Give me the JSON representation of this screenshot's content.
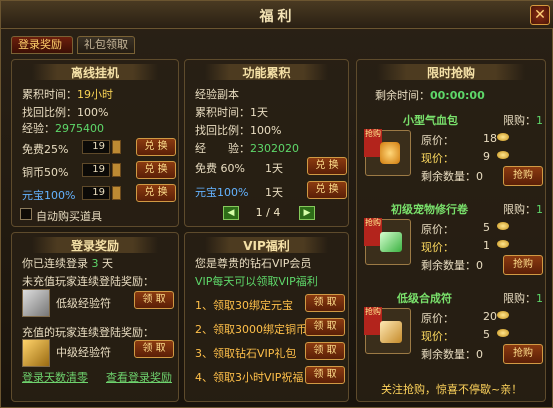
{
  "window": {
    "title": "福利"
  },
  "tabs": [
    {
      "label": "登录奖励"
    },
    {
      "label": "礼包领取"
    }
  ],
  "offline": {
    "title": "离线挂机",
    "time": {
      "label": "累积时间：",
      "value": "19小时"
    },
    "ratio": {
      "label": "找回比例：",
      "value": "100%"
    },
    "exp": {
      "label": "经验：",
      "value": "2975400"
    },
    "rows": [
      {
        "label": "免费25%",
        "value": "19",
        "button": "兑 换"
      },
      {
        "label": "铜币50%",
        "value": "19",
        "button": "兑 换"
      },
      {
        "label": "元宝100%",
        "value": "19",
        "button": "兑 换"
      }
    ],
    "auto_buy": "自动购买道具"
  },
  "function": {
    "title": "功能累积",
    "subtitle": "经验副本",
    "time": {
      "label": "累积时间：",
      "value": "1天"
    },
    "ratio": {
      "label": "找回比例：",
      "value": "100%"
    },
    "exp": {
      "label": "经　　验：",
      "value": "2302020"
    },
    "rows": [
      {
        "label": "免费 60%",
        "value": "1天",
        "button": "兑 换"
      },
      {
        "label": "元宝100%",
        "value": "1天",
        "button": "兑 换"
      }
    ],
    "page": "1 / 4"
  },
  "login": {
    "title": "登录奖励",
    "streak_prefix": "你已连续登录",
    "streak_days": "3",
    "streak_suffix": "天",
    "normal_reward_label": "未充值玩家连续登陆奖励：",
    "normal_reward_item": "低级经验符",
    "vip_reward_label": "充值的玩家连续登陆奖励：",
    "vip_reward_item": "中级经验符",
    "claim": "领 取",
    "link_clear": "登录天数清零",
    "link_view": "查看登录奖励"
  },
  "vip": {
    "title": "VIP福利",
    "subtitle": "您是尊贵的钻石VIP会员",
    "daily": "VIP每天可以领取VIP福利",
    "items": [
      {
        "label": "1、领取30绑定元宝"
      },
      {
        "label": "2、领取3000绑定铜币"
      },
      {
        "label": "3、领取钻石VIP礼包"
      },
      {
        "label": "4、领取3小时VIP祝福"
      }
    ],
    "claim": "领 取"
  },
  "flash_sale": {
    "title": "限时抢购",
    "remaining_label": "剩余时间：",
    "remaining_time": "00:00:00",
    "footer": "关注抢购，惊喜不停歇~亲！",
    "items": [
      {
        "name": "小型气血包",
        "limit_label": "限购：",
        "limit": "1",
        "orig_label": "原价：",
        "orig": "18",
        "now_label": "现价：",
        "now": "9",
        "remain_label": "剩余数量：",
        "remain": "0",
        "button": "抢购",
        "badge": "抢购"
      },
      {
        "name": "初级宠物修行卷",
        "limit_label": "限购：",
        "limit": "1",
        "orig_label": "原价：",
        "orig": "5",
        "now_label": "现价：",
        "now": "1",
        "remain_label": "剩余数量：",
        "remain": "0",
        "button": "抢购",
        "badge": "抢购"
      },
      {
        "name": "低级合成符",
        "limit_label": "限购：",
        "limit": "1",
        "orig_label": "原价：",
        "orig": "20",
        "now_label": "现价：",
        "now": "5",
        "remain_label": "剩余数量：",
        "remain": "0",
        "button": "抢购",
        "badge": "抢购"
      }
    ]
  }
}
